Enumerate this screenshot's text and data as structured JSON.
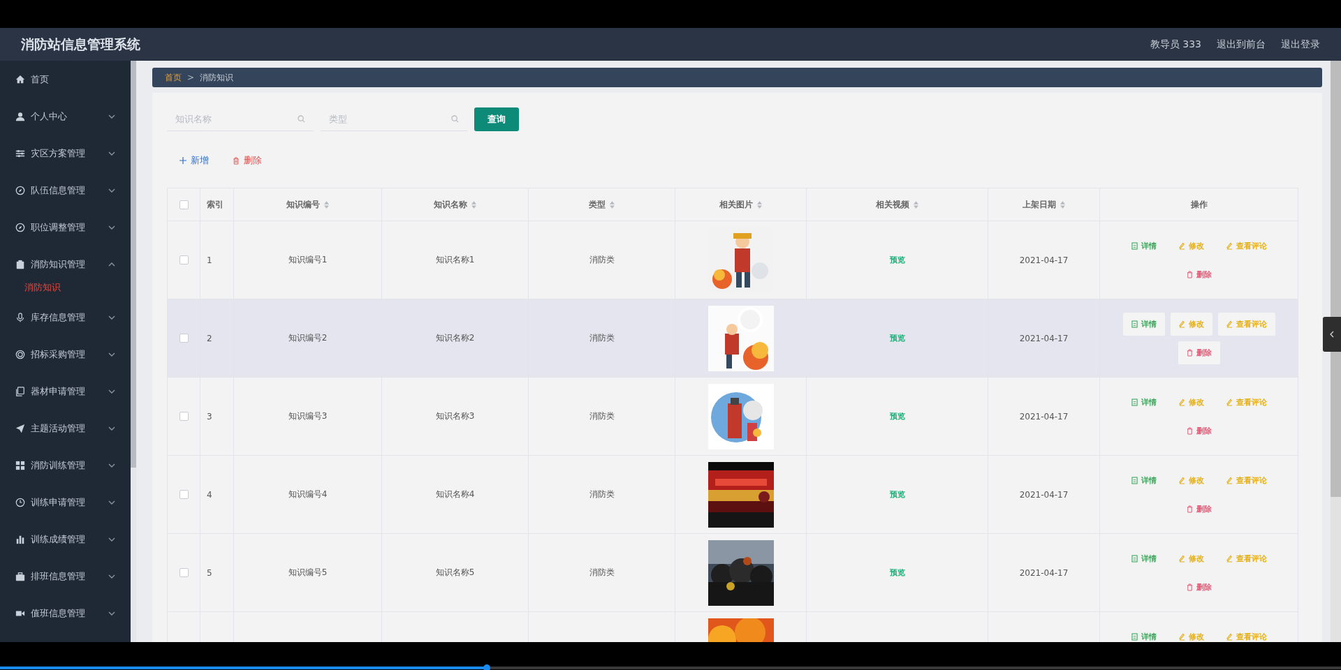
{
  "header": {
    "title": "消防站信息管理系统",
    "user": "教导员 333",
    "links": [
      "退出到前台",
      "退出登录"
    ]
  },
  "sidebar": {
    "items": [
      {
        "label": "首页",
        "kind": "link"
      },
      {
        "label": "个人中心",
        "kind": "menu",
        "expanded": false
      },
      {
        "label": "灾区方案管理",
        "kind": "menu",
        "expanded": false
      },
      {
        "label": "队伍信息管理",
        "kind": "menu",
        "expanded": false
      },
      {
        "label": "职位调整管理",
        "kind": "menu",
        "expanded": false
      },
      {
        "label": "消防知识管理",
        "kind": "menu",
        "expanded": true,
        "children": [
          {
            "label": "消防知识",
            "selected": true
          }
        ]
      },
      {
        "label": "库存信息管理",
        "kind": "menu",
        "expanded": false
      },
      {
        "label": "招标采购管理",
        "kind": "menu",
        "expanded": false
      },
      {
        "label": "器材申请管理",
        "kind": "menu",
        "expanded": false
      },
      {
        "label": "主题活动管理",
        "kind": "menu",
        "expanded": false
      },
      {
        "label": "消防训练管理",
        "kind": "menu",
        "expanded": false
      },
      {
        "label": "训练申请管理",
        "kind": "menu",
        "expanded": false
      },
      {
        "label": "训练成绩管理",
        "kind": "menu",
        "expanded": false
      },
      {
        "label": "排班信息管理",
        "kind": "menu",
        "expanded": false
      },
      {
        "label": "值班信息管理",
        "kind": "menu",
        "expanded": false
      }
    ]
  },
  "breadcrumb": {
    "items": [
      "首页",
      "消防知识"
    ],
    "separator": ">"
  },
  "search": {
    "fields": [
      {
        "placeholder": "知识名称"
      },
      {
        "placeholder": "类型"
      }
    ],
    "button": "查询"
  },
  "toolbar": {
    "add": "新增",
    "delete": "删除"
  },
  "table": {
    "all_checked": false,
    "columns": [
      {
        "label": "索引",
        "sortable": false
      },
      {
        "label": "知识编号",
        "sortable": true
      },
      {
        "label": "知识名称",
        "sortable": true
      },
      {
        "label": "类型",
        "sortable": true
      },
      {
        "label": "相关图片",
        "sortable": true
      },
      {
        "label": "相关视频",
        "sortable": true
      },
      {
        "label": "上架日期",
        "sortable": true
      },
      {
        "label": "操作",
        "sortable": false
      }
    ],
    "rows": [
      {
        "checked": false,
        "highlighted": false,
        "index": "1",
        "code": "知识编号1",
        "name": "知识名称1",
        "type": "消防类",
        "image": {
          "kind": "picture"
        },
        "video": "预览",
        "date": "2021-04-17",
        "actions": [
          {
            "label": "详情",
            "kind": "detail"
          },
          {
            "label": "修改",
            "kind": "edit"
          },
          {
            "label": "查看评论",
            "kind": "comment"
          },
          {
            "label": "删除",
            "kind": "delete"
          }
        ]
      },
      {
        "checked": false,
        "highlighted": true,
        "index": "2",
        "code": "知识编号2",
        "name": "知识名称2",
        "type": "消防类",
        "image": {
          "kind": "picture"
        },
        "video": "预览",
        "date": "2021-04-17",
        "actions": [
          {
            "label": "详情",
            "kind": "detail"
          },
          {
            "label": "修改",
            "kind": "edit"
          },
          {
            "label": "查看评论",
            "kind": "comment"
          },
          {
            "label": "删除",
            "kind": "delete"
          }
        ]
      },
      {
        "checked": false,
        "highlighted": false,
        "index": "3",
        "code": "知识编号3",
        "name": "知识名称3",
        "type": "消防类",
        "image": {
          "kind": "picture"
        },
        "video": "预览",
        "date": "2021-04-17",
        "actions": [
          {
            "label": "详情",
            "kind": "detail"
          },
          {
            "label": "修改",
            "kind": "edit"
          },
          {
            "label": "查看评论",
            "kind": "comment"
          },
          {
            "label": "删除",
            "kind": "delete"
          }
        ]
      },
      {
        "checked": false,
        "highlighted": false,
        "index": "4",
        "code": "知识编号4",
        "name": "知识名称4",
        "type": "消防类",
        "image": {
          "kind": "picture"
        },
        "video": "预览",
        "date": "2021-04-17",
        "actions": [
          {
            "label": "详情",
            "kind": "detail"
          },
          {
            "label": "修改",
            "kind": "edit"
          },
          {
            "label": "查看评论",
            "kind": "comment"
          },
          {
            "label": "删除",
            "kind": "delete"
          }
        ]
      },
      {
        "checked": false,
        "highlighted": false,
        "index": "5",
        "code": "知识编号5",
        "name": "知识名称5",
        "type": "消防类",
        "image": {
          "kind": "picture"
        },
        "video": "预览",
        "date": "2021-04-17",
        "actions": [
          {
            "label": "详情",
            "kind": "detail"
          },
          {
            "label": "修改",
            "kind": "edit"
          },
          {
            "label": "查看评论",
            "kind": "comment"
          },
          {
            "label": "删除",
            "kind": "delete"
          }
        ]
      },
      {
        "image": {
          "kind": "picture"
        },
        "actions": [
          {
            "label": "详情",
            "kind": "detail"
          },
          {
            "label": "修改",
            "kind": "edit"
          },
          {
            "label": "查看评论",
            "kind": "comment"
          }
        ]
      }
    ]
  },
  "player": {
    "progress": {
      "level": 0.363
    }
  }
}
